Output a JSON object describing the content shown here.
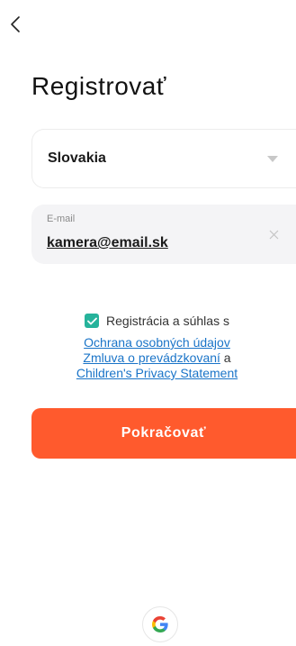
{
  "header": {
    "back_icon": "chevron-left-icon",
    "title": "Registrovať"
  },
  "form": {
    "country": {
      "value": "Slovakia",
      "icon": "caret-down-icon"
    },
    "email": {
      "label": "E-mail",
      "value": "kamera@email.sk",
      "clear_icon": "close-icon"
    }
  },
  "consent": {
    "checked": true,
    "text": "Registrácia a súhlas s",
    "privacy_link": "Ochrana osobných údajov",
    "terms_link": "Zmluva o prevádzkovaní",
    "conjunction": " a",
    "children_link": "Children's Privacy Statement"
  },
  "actions": {
    "continue_label": "Pokračovať",
    "google_icon": "google-icon"
  },
  "colors": {
    "accent": "#ff5a2d",
    "checkbox": "#26b39b",
    "link": "#1a74c8"
  }
}
